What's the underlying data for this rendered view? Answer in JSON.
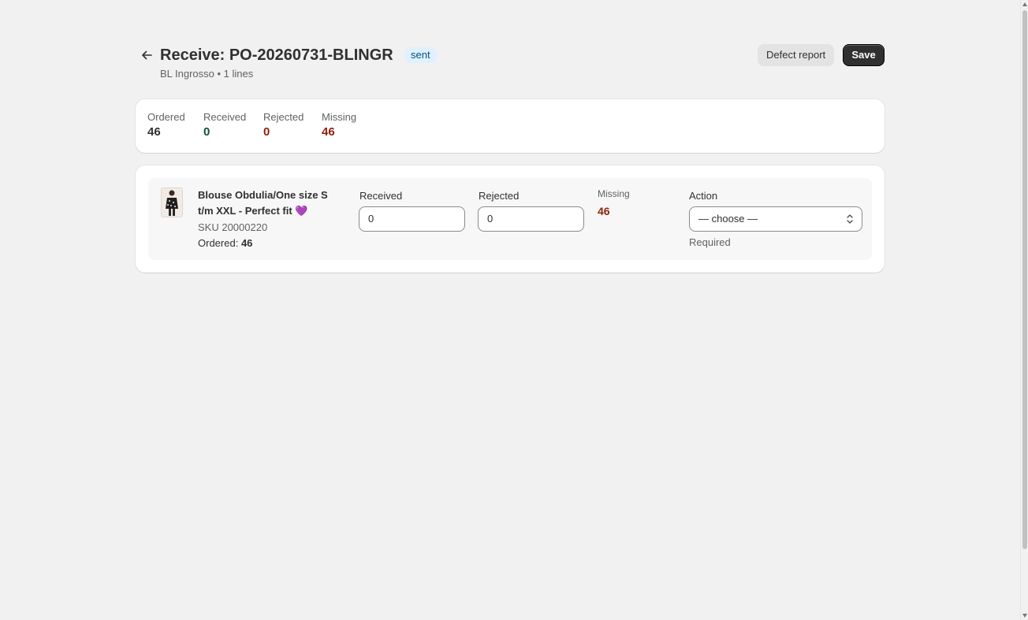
{
  "header": {
    "back_icon": "arrow-left-icon",
    "title": "Receive: PO-20260731-BLINGR",
    "status_badge": "sent",
    "subtitle": "BL Ingrosso • 1 lines",
    "defect_report_label": "Defect report",
    "save_label": "Save"
  },
  "summary": {
    "ordered": {
      "label": "Ordered",
      "value": "46"
    },
    "received": {
      "label": "Received",
      "value": "0"
    },
    "rejected": {
      "label": "Rejected",
      "value": "0"
    },
    "missing": {
      "label": "Missing",
      "value": "46"
    }
  },
  "colors": {
    "received_value": "#0c5132",
    "rejected_value": "#8e1f0b",
    "missing_value": "#8e1f0b",
    "badge_bg": "#e0f0ff",
    "primary_button": "#303030"
  },
  "line_items": [
    {
      "product_title": "Blouse Obdulia/One size S t/m XXL - Perfect fit 💜",
      "sku": "SKU 20000220",
      "ordered_label": "Ordered:",
      "ordered_value": "46",
      "received_label": "Received",
      "received_value": "0",
      "rejected_label": "Rejected",
      "rejected_value": "0",
      "missing_label": "Missing",
      "missing_value": "46",
      "action_label": "Action",
      "action_selected": "— choose —",
      "action_hint": "Required"
    }
  ]
}
